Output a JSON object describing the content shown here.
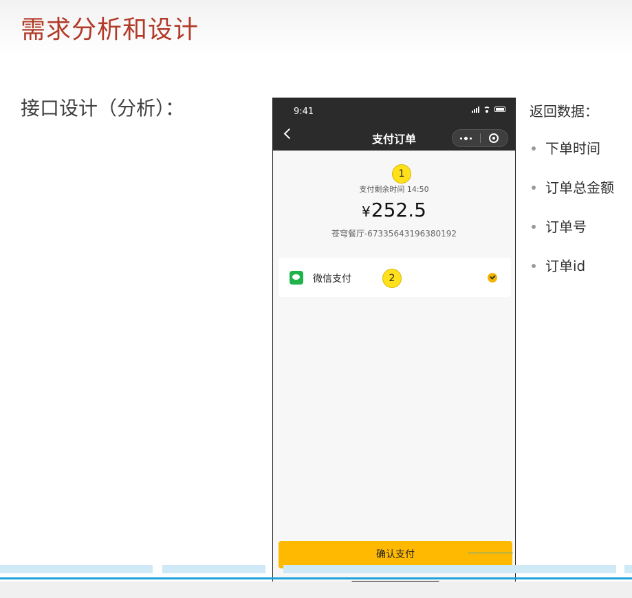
{
  "slide": {
    "title": "需求分析和设计",
    "section_label": "接口设计（分析）："
  },
  "phone": {
    "status_time": "9:41",
    "nav_title": "支付订单",
    "badge_1": "1",
    "badge_2": "2",
    "remaining_time": "支付剩余时间 14:50",
    "amount_symbol": "¥",
    "amount": "252.5",
    "merchant_order": "苍穹餐厅-67335643196380192",
    "payment_method": "微信支付",
    "confirm_label": "确认支付",
    "icons": [
      "signal-icon",
      "wifi-icon",
      "battery-icon",
      "back-icon",
      "more-icon",
      "close-icon",
      "wechat-pay-icon",
      "check-icon"
    ],
    "colors": {
      "header": "#2b2b2b",
      "accent": "#ffb900",
      "badge": "#ffe01a",
      "wechat": "#22b24c"
    }
  },
  "return_data": {
    "heading": "返回数据：",
    "items": [
      "下单时间",
      "订单总金额",
      "订单号",
      "订单id"
    ]
  },
  "colors": {
    "title": "#b23a28",
    "bottom_line": "#1ea0d8"
  }
}
